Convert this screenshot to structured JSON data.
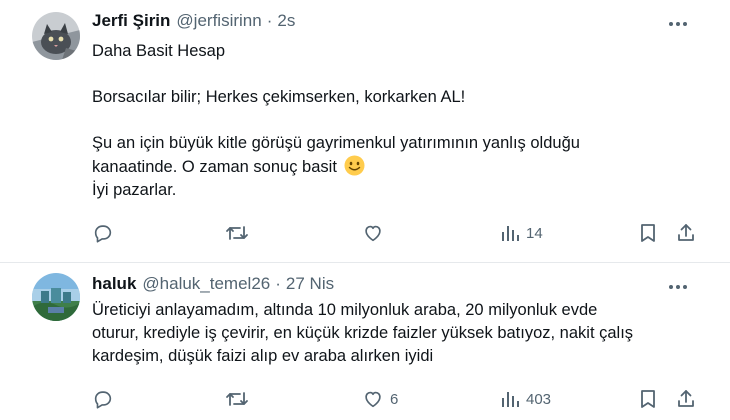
{
  "tweets": [
    {
      "author_name": "Jerfi Şirin",
      "handle": "@jerfisirinn",
      "separator": "·",
      "time": "2s",
      "lines": [
        "Daha Basit Hesap",
        "",
        "Borsacılar bilir; Herkes çekimserken, korkarken AL!",
        "",
        "Şu an için büyük kitle görüşü gayrimenkul yatırımının yanlış olduğu",
        "kanaatinde. O zaman sonuç basit",
        "İyi pazarlar."
      ],
      "emoji": "slightly-smiling-face",
      "stats": {
        "replies": "",
        "retweets": "",
        "likes": "",
        "views": "14"
      }
    },
    {
      "author_name": "haluk",
      "handle": "@haluk_temel26",
      "separator": "·",
      "time": "27 Nis",
      "lines": [
        "Üreticiyi anlayamadım, altında 10 milyonluk araba, 20 milyonluk evde",
        "oturur, krediyle iş çevirir, en küçük krizde faizler yüksek batıyoz, nakit çalış",
        "kardeşim, düşük faizi alıp ev araba alırken iyidi"
      ],
      "stats": {
        "replies": "",
        "retweets": "",
        "likes": "6",
        "views": "403"
      }
    }
  ],
  "icons": {
    "more": "more-horizontal-icon",
    "reply": "reply-icon",
    "retweet": "retweet-icon",
    "like": "like-icon",
    "views": "views-icon",
    "bookmark": "bookmark-icon",
    "share": "share-icon"
  },
  "colors": {
    "text": "#0f1419",
    "secondary": "#536471",
    "border": "#e6e9ec",
    "emoji": "#ffcc4d"
  }
}
